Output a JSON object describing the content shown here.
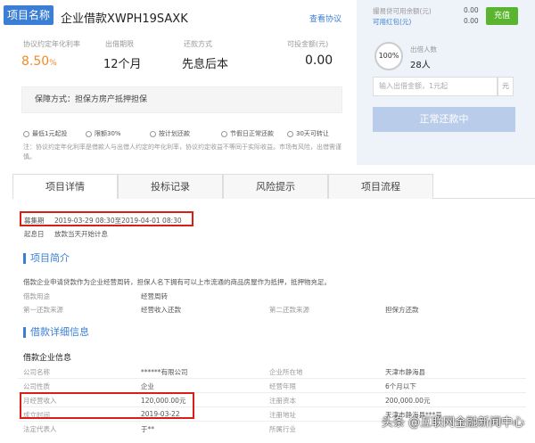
{
  "header": {
    "badge": "项目名称",
    "title": "企业借款XWPH19SAXK",
    "agreement_link": "查看协议"
  },
  "stats": {
    "rate_label": "协议约定年化利率",
    "rate_value": "8.50",
    "rate_unit": "%",
    "period_label": "出借期限",
    "period_value": "12个月",
    "repay_label": "还款方式",
    "repay_value": "先息后本",
    "available_label": "可投金额(元)",
    "available_value": "0.00"
  },
  "guarantee": "保障方式：担保方房产抵押担保",
  "features": [
    "最低1元起投",
    "限额30%",
    "按计划还款",
    "节假日正常还款",
    "30天可转让"
  ],
  "note": "注：协议约定年化利率是借款人与出借人约定的年化利率，协议约定收益不等同于实际收益。市场有风险，出借需谨慎。",
  "side": {
    "balance_label": "撮易贷可用余额(元)",
    "balance_value": "0.00",
    "redpacket_label": "可用红包(元)",
    "redpacket_value": "0.00",
    "recharge_button": "充值",
    "progress": "100%",
    "investors_label": "出借人数",
    "investors_value": "28人",
    "amount_placeholder": "输入出借金额，1元起",
    "yuan": "元",
    "status_button": "正常还款中"
  },
  "tabs": [
    "项目详情",
    "投标记录",
    "风险提示",
    "项目流程"
  ],
  "details": {
    "raise_label": "募集期",
    "raise_value": "2019-03-29 08:30至2019-04-01 08:30",
    "interest_label": "起息日",
    "interest_value": "放款当天开始计息"
  },
  "intro": {
    "title": "项目简介",
    "text": "借款企业申请贷款作为企业经营周转，担保人名下拥有可以上市流通的商品房屋作为抵押，抵押物充足。",
    "purpose_label": "借款用途",
    "purpose_value": "经营周转",
    "first_source_label": "第一还款来源",
    "first_source_value": "经营收入还款",
    "second_source_label": "第二还款来源",
    "second_source_value": "担保方还款"
  },
  "loan": {
    "title": "借款详细信息",
    "company_title": "借款企业信息",
    "rows": [
      {
        "l1": "公司名称",
        "v1": "******有限公司",
        "l2": "企业所在地",
        "v2": "天津市静海县"
      },
      {
        "l1": "公司性质",
        "v1": "企业",
        "l2": "经营年限",
        "v2": "6个月以下"
      },
      {
        "l1": "月经营收入",
        "v1": "120,000.00元",
        "l2": "注册资本",
        "v2": "200,000.00元"
      },
      {
        "l1": "成立时间",
        "v1": "2019-03-22",
        "l2": "注册地址",
        "v2": "天津市静海县***号"
      },
      {
        "l1": "法定代表人",
        "v1": "于**",
        "l2": "所属行业",
        "v2": ""
      }
    ]
  },
  "watermark": "头条 @互联网金融新闻中心"
}
